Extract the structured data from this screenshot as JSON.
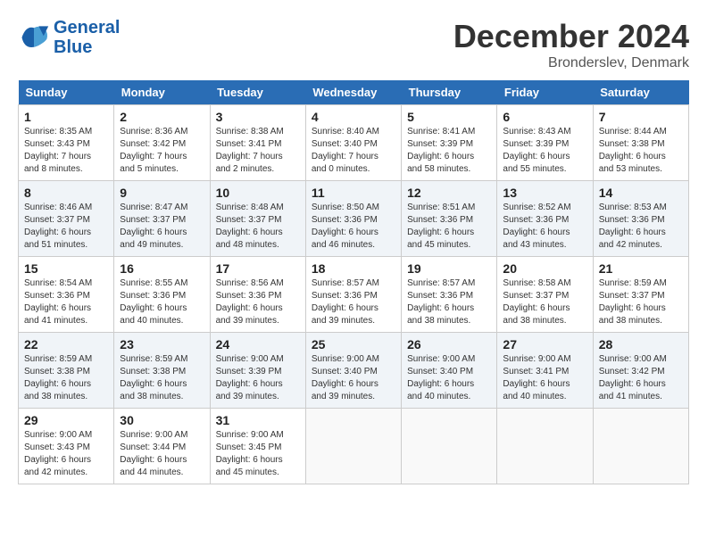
{
  "header": {
    "logo_line1": "General",
    "logo_line2": "Blue",
    "month_title": "December 2024",
    "location": "Bronderslev, Denmark"
  },
  "days_of_week": [
    "Sunday",
    "Monday",
    "Tuesday",
    "Wednesday",
    "Thursday",
    "Friday",
    "Saturday"
  ],
  "weeks": [
    [
      {
        "day": "1",
        "sunrise": "8:35 AM",
        "sunset": "3:43 PM",
        "daylight": "7 hours and 8 minutes."
      },
      {
        "day": "2",
        "sunrise": "8:36 AM",
        "sunset": "3:42 PM",
        "daylight": "7 hours and 5 minutes."
      },
      {
        "day": "3",
        "sunrise": "8:38 AM",
        "sunset": "3:41 PM",
        "daylight": "7 hours and 2 minutes."
      },
      {
        "day": "4",
        "sunrise": "8:40 AM",
        "sunset": "3:40 PM",
        "daylight": "7 hours and 0 minutes."
      },
      {
        "day": "5",
        "sunrise": "8:41 AM",
        "sunset": "3:39 PM",
        "daylight": "6 hours and 58 minutes."
      },
      {
        "day": "6",
        "sunrise": "8:43 AM",
        "sunset": "3:39 PM",
        "daylight": "6 hours and 55 minutes."
      },
      {
        "day": "7",
        "sunrise": "8:44 AM",
        "sunset": "3:38 PM",
        "daylight": "6 hours and 53 minutes."
      }
    ],
    [
      {
        "day": "8",
        "sunrise": "8:46 AM",
        "sunset": "3:37 PM",
        "daylight": "6 hours and 51 minutes."
      },
      {
        "day": "9",
        "sunrise": "8:47 AM",
        "sunset": "3:37 PM",
        "daylight": "6 hours and 49 minutes."
      },
      {
        "day": "10",
        "sunrise": "8:48 AM",
        "sunset": "3:37 PM",
        "daylight": "6 hours and 48 minutes."
      },
      {
        "day": "11",
        "sunrise": "8:50 AM",
        "sunset": "3:36 PM",
        "daylight": "6 hours and 46 minutes."
      },
      {
        "day": "12",
        "sunrise": "8:51 AM",
        "sunset": "3:36 PM",
        "daylight": "6 hours and 45 minutes."
      },
      {
        "day": "13",
        "sunrise": "8:52 AM",
        "sunset": "3:36 PM",
        "daylight": "6 hours and 43 minutes."
      },
      {
        "day": "14",
        "sunrise": "8:53 AM",
        "sunset": "3:36 PM",
        "daylight": "6 hours and 42 minutes."
      }
    ],
    [
      {
        "day": "15",
        "sunrise": "8:54 AM",
        "sunset": "3:36 PM",
        "daylight": "6 hours and 41 minutes."
      },
      {
        "day": "16",
        "sunrise": "8:55 AM",
        "sunset": "3:36 PM",
        "daylight": "6 hours and 40 minutes."
      },
      {
        "day": "17",
        "sunrise": "8:56 AM",
        "sunset": "3:36 PM",
        "daylight": "6 hours and 39 minutes."
      },
      {
        "day": "18",
        "sunrise": "8:57 AM",
        "sunset": "3:36 PM",
        "daylight": "6 hours and 39 minutes."
      },
      {
        "day": "19",
        "sunrise": "8:57 AM",
        "sunset": "3:36 PM",
        "daylight": "6 hours and 38 minutes."
      },
      {
        "day": "20",
        "sunrise": "8:58 AM",
        "sunset": "3:37 PM",
        "daylight": "6 hours and 38 minutes."
      },
      {
        "day": "21",
        "sunrise": "8:59 AM",
        "sunset": "3:37 PM",
        "daylight": "6 hours and 38 minutes."
      }
    ],
    [
      {
        "day": "22",
        "sunrise": "8:59 AM",
        "sunset": "3:38 PM",
        "daylight": "6 hours and 38 minutes."
      },
      {
        "day": "23",
        "sunrise": "8:59 AM",
        "sunset": "3:38 PM",
        "daylight": "6 hours and 38 minutes."
      },
      {
        "day": "24",
        "sunrise": "9:00 AM",
        "sunset": "3:39 PM",
        "daylight": "6 hours and 39 minutes."
      },
      {
        "day": "25",
        "sunrise": "9:00 AM",
        "sunset": "3:40 PM",
        "daylight": "6 hours and 39 minutes."
      },
      {
        "day": "26",
        "sunrise": "9:00 AM",
        "sunset": "3:40 PM",
        "daylight": "6 hours and 40 minutes."
      },
      {
        "day": "27",
        "sunrise": "9:00 AM",
        "sunset": "3:41 PM",
        "daylight": "6 hours and 40 minutes."
      },
      {
        "day": "28",
        "sunrise": "9:00 AM",
        "sunset": "3:42 PM",
        "daylight": "6 hours and 41 minutes."
      }
    ],
    [
      {
        "day": "29",
        "sunrise": "9:00 AM",
        "sunset": "3:43 PM",
        "daylight": "6 hours and 42 minutes."
      },
      {
        "day": "30",
        "sunrise": "9:00 AM",
        "sunset": "3:44 PM",
        "daylight": "6 hours and 44 minutes."
      },
      {
        "day": "31",
        "sunrise": "9:00 AM",
        "sunset": "3:45 PM",
        "daylight": "6 hours and 45 minutes."
      },
      null,
      null,
      null,
      null
    ]
  ],
  "labels": {
    "sunrise": "Sunrise:",
    "sunset": "Sunset:",
    "daylight": "Daylight:"
  }
}
